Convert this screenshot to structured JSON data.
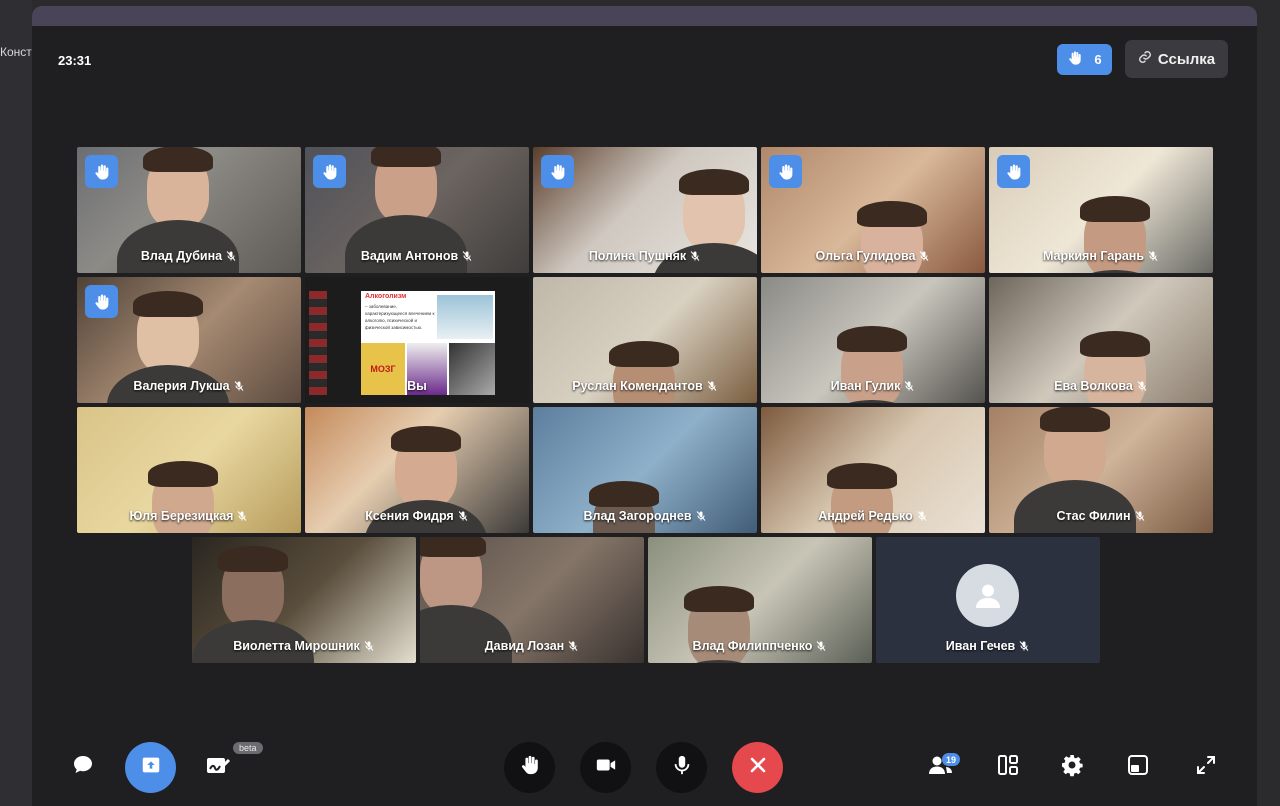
{
  "left_strip": {
    "label": "Конст"
  },
  "header": {
    "time": "23:31",
    "raised_hands_count": "6",
    "link_label": "Ссылка"
  },
  "participants": [
    {
      "name": "Влад Дубина",
      "hand_raised": true
    },
    {
      "name": "Вадим Антонов",
      "hand_raised": true
    },
    {
      "name": "Полина Пушняк",
      "hand_raised": true
    },
    {
      "name": "Ольга Гулидова",
      "hand_raised": true
    },
    {
      "name": "Маркиян Гарань",
      "hand_raised": true
    },
    {
      "name": "Валерия Лукша",
      "hand_raised": true
    },
    {
      "name": "Вы",
      "hand_raised": false
    },
    {
      "name": "Руслан Комендантов",
      "hand_raised": false
    },
    {
      "name": "Иван Гулик",
      "hand_raised": false
    },
    {
      "name": "Ева Волкова",
      "hand_raised": false
    },
    {
      "name": "Юля Березицкая",
      "hand_raised": false
    },
    {
      "name": "Ксения Фидря",
      "hand_raised": false
    },
    {
      "name": "Влад Загороднев",
      "hand_raised": false
    },
    {
      "name": "Андрей Редько",
      "hand_raised": false
    },
    {
      "name": "Стас Филин",
      "hand_raised": false
    },
    {
      "name": "Виолетта Мирошник",
      "hand_raised": false
    },
    {
      "name": "Давид Лозан",
      "hand_raised": false
    },
    {
      "name": "Влад Филиппченко",
      "hand_raised": false
    },
    {
      "name": "Иван Гечев",
      "hand_raised": false
    }
  ],
  "shared_slide": {
    "title": "Алкоголизм",
    "text": "– заболевание, характеризующееся влечением к алкоголю, психической и физической зависимостью.",
    "poster_text": "МОЗГ"
  },
  "toolbar": {
    "beta_label": "beta",
    "participants_count": "19"
  },
  "colors": {
    "accent": "#4d8ee8",
    "end_call": "#e5484d",
    "background": "#1f1f21"
  }
}
